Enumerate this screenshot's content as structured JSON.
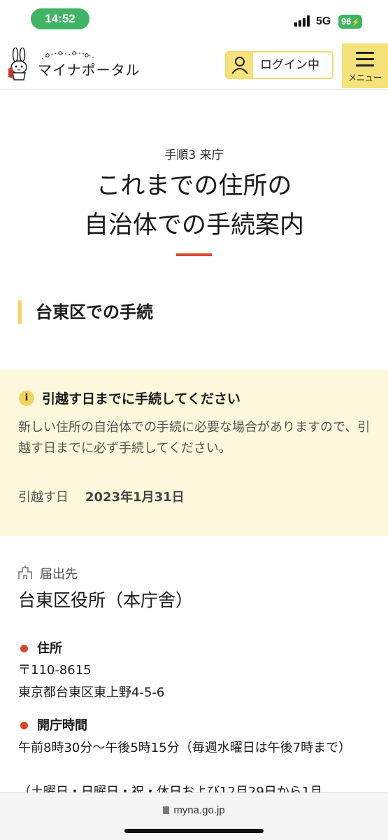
{
  "status_bar": {
    "time": "14:52",
    "network": "5G",
    "battery": "96"
  },
  "header": {
    "logo_text": "マイナポータル",
    "login_label": "ログイン中",
    "menu_label": "メニュー"
  },
  "page": {
    "step": "手順3 来庁",
    "title_line1": "これまでの住所の",
    "title_line2": "自治体での手続案内",
    "section_heading": "台東区での手続"
  },
  "notice": {
    "icon": "info-icon",
    "title": "引越す日までに手続してください",
    "body": "新しい住所の自治体での手続に必要な場合がありますので、引越す日までに必ず手続してください。",
    "move_label": "引越す日",
    "move_date": "2023年1月31日"
  },
  "office": {
    "dest_label": "届出先",
    "name": "台東区役所（本庁舎）",
    "address_head": "住所",
    "postal": "〒110-8615",
    "address": "東京都台東区東上野4-5-6",
    "hours_head": "開庁時間",
    "hours": "午前8時30分〜午後5時15分（毎週水曜日は午後7時まで）",
    "hours_note": "（土曜日・日曜日・祝・休日および12月29日から1月"
  },
  "browser": {
    "url": "myna.go.jp"
  },
  "colors": {
    "accent_yellow": "#f6e27a",
    "accent_red": "#d9472b",
    "notice_bg": "#fdf7dc",
    "status_green": "#3fb464"
  }
}
